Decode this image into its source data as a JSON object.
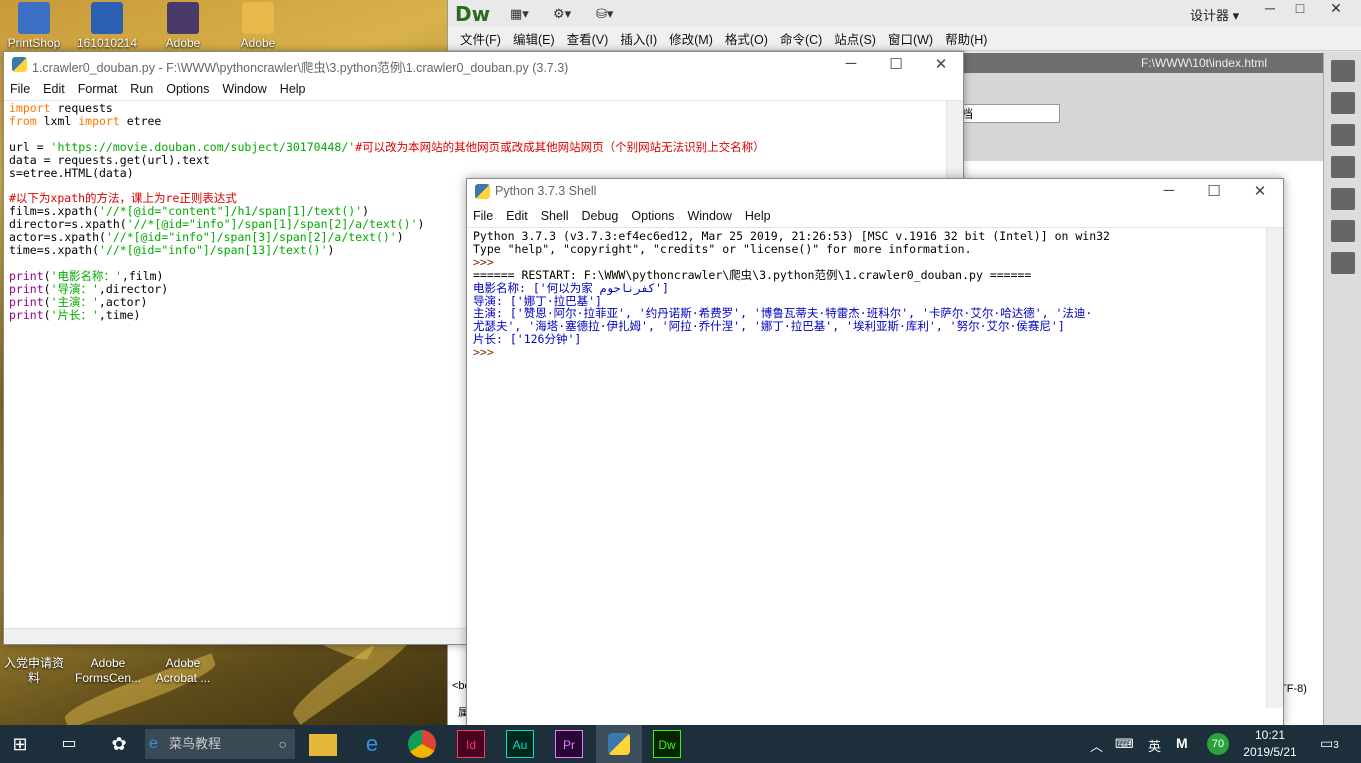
{
  "desktop": {
    "icons": [
      {
        "label": "PrintShop",
        "color": "#3a6fc4"
      },
      {
        "label": "161010214",
        "color": "#2b5fb2"
      },
      {
        "label": "Adobe",
        "color": "#4a3a6a"
      },
      {
        "label": "Adobe",
        "color": "#e8b84a"
      },
      {
        "label": "入党申请资\n料",
        "color": "#888"
      },
      {
        "label": "Adobe\nFormsCen...",
        "color": "#888"
      },
      {
        "label": "Adobe\nAcrobat ...",
        "color": "#888"
      }
    ]
  },
  "dw": {
    "logo": "Dw",
    "mode_label": "设计器",
    "menu": [
      "文件(F)",
      "编辑(E)",
      "查看(V)",
      "插入(I)",
      "修改(M)",
      "格式(O)",
      "命令(C)",
      "站点(S)",
      "窗口(W)",
      "帮助(H)"
    ],
    "path": "F:\\WWW\\10t\\index.html",
    "field_text": "档",
    "bottom_left": "<bo",
    "bottom_right": "TF-8)",
    "bottom_left2": "属"
  },
  "editor": {
    "title": "1.crawler0_douban.py - F:\\WWW\\pythoncrawler\\爬虫\\3.python范例\\1.crawler0_douban.py (3.7.3)",
    "menu": [
      "File",
      "Edit",
      "Format",
      "Run",
      "Options",
      "Window",
      "Help"
    ]
  },
  "shell": {
    "title": "Python 3.7.3 Shell",
    "menu": [
      "File",
      "Edit",
      "Shell",
      "Debug",
      "Options",
      "Window",
      "Help"
    ],
    "line1": "Python 3.7.3 (v3.7.3:ef4ec6ed12, Mar 25 2019, 21:26:53) [MSC v.1916 32 bit (Intel)] on win32",
    "line2": "Type \"help\", \"copyright\", \"credits\" or \"license()\" for more information.",
    "prompt": ">>> ",
    "restart": "====== RESTART: F:\\WWW\\pythoncrawler\\爬虫\\3.python范例\\1.crawler0_douban.py ======",
    "out1": "电影名称: ['何以为家 كفرناحوم']",
    "out2": "导演: ['娜丁·拉巴基']",
    "out3": "主演: ['赞恩·阿尔·拉菲亚', '约丹诺斯·希费罗', '博鲁瓦蒂夫·特雷杰·班科尔', '卡萨尔·艾尔·哈达德', '法迪·",
    "out4": "尤瑟夫', '海塔·塞德拉·伊扎姆', '阿拉·乔什涅', '娜丁·拉巴基', '埃利亚斯·库利', '努尔·艾尔·侯赛尼']",
    "out5": "片长: ['126分钟']"
  },
  "taskbar": {
    "search_placeholder": "菜鸟教程",
    "apps": [
      {
        "label": "Id",
        "color": "#49021f",
        "fg": "#ff3366"
      },
      {
        "label": "Au",
        "color": "#00261e",
        "fg": "#00e4bb"
      },
      {
        "label": "Pr",
        "color": "#2a0634",
        "fg": "#e77bff"
      },
      {
        "label": "Dw",
        "color": "#072401",
        "fg": "#35fa00"
      }
    ],
    "ime": "英",
    "ime2": "M",
    "badge": "70",
    "time": "10:21",
    "date": "2019/5/21",
    "notifications": "3"
  }
}
